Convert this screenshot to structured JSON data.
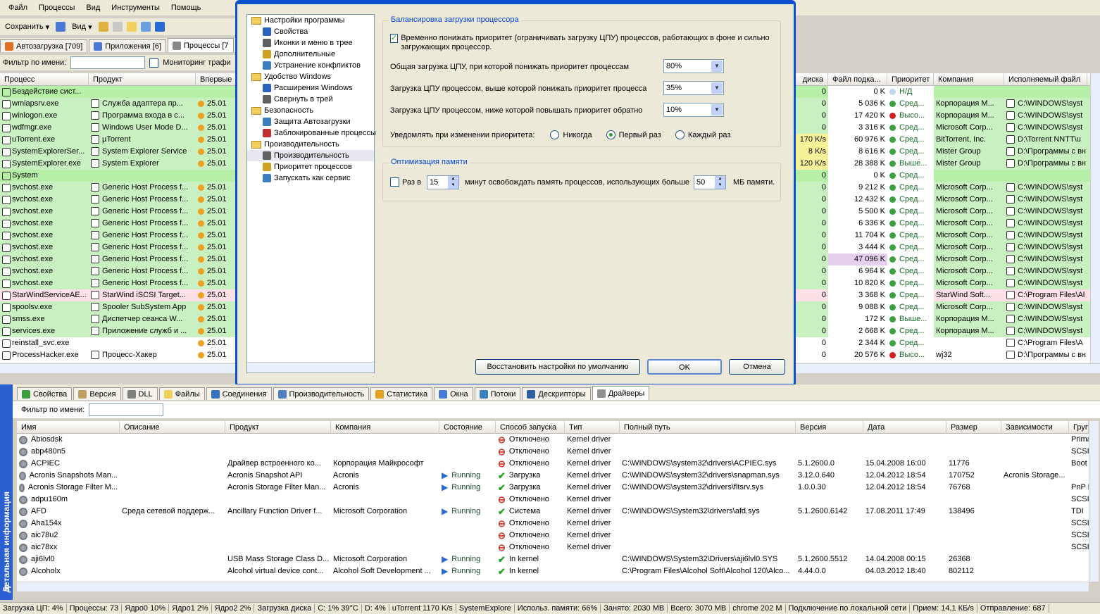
{
  "menu": [
    "Файл",
    "Процессы",
    "Вид",
    "Инструменты",
    "Помощь"
  ],
  "toolbar": {
    "save": "Сохранить",
    "view": "Вид"
  },
  "top_tabs": [
    "Автозагрузка [709]",
    "Приложения [6]",
    "Процессы [7"
  ],
  "filter": {
    "label": "Фильтр по имени:",
    "monitor": "Мониторинг трафи"
  },
  "proc_headers_left": [
    "Процесс",
    "Продукт",
    "Впервые"
  ],
  "proc_headers_right": [
    "диска",
    "Файл подка...",
    "Приоритет",
    "Компания",
    "Исполняемый файл"
  ],
  "processes": [
    {
      "n": "Бездействие сист...",
      "p": "",
      "d": "",
      "disk": "0",
      "f": "0 K",
      "pr": "Н/Д",
      "c": "",
      "e": "",
      "bg": "gb"
    },
    {
      "n": "wmiapsrv.exe",
      "p": "Служба адаптера пр...",
      "d": "25.01",
      "disk": "0",
      "f": "5 036 K",
      "pr": "Сред...",
      "c": "Корпорация M...",
      "e": "C:\\WINDOWS\\syst",
      "bg": "g"
    },
    {
      "n": "winlogon.exe",
      "p": "Программа входа в с...",
      "d": "25.01",
      "disk": "0",
      "f": "17 420 K",
      "pr": "Высо...",
      "c": "Корпорация M...",
      "e": "C:\\WINDOWS\\syst",
      "bg": "g"
    },
    {
      "n": "wdfmgr.exe",
      "p": "Windows User Mode D...",
      "d": "25.01",
      "disk": "0",
      "f": "3 316 K",
      "pr": "Сред...",
      "c": "Microsoft Corp...",
      "e": "C:\\WINDOWS\\syst",
      "bg": "g"
    },
    {
      "n": "uTorrent.exe",
      "p": "µTorrent",
      "d": "25.01",
      "disk": "170 K/s",
      "f": "60 976 K",
      "pr": "Сред...",
      "c": "BitTorrent, Inc.",
      "e": "D:\\Torrent NNTT\\u",
      "bg": "g"
    },
    {
      "n": "SystemExplorerSer...",
      "p": "System Explorer Service",
      "d": "25.01",
      "disk": "8 K/s",
      "f": "8 616 K",
      "pr": "Сред...",
      "c": "Mister Group",
      "e": "D:\\Программы с вн",
      "bg": "g"
    },
    {
      "n": "SystemExplorer.exe",
      "p": "System Explorer",
      "d": "25.01",
      "disk": "120 K/s",
      "f": "28 388 K",
      "pr": "Выше...",
      "c": "Mister Group",
      "e": "D:\\Программы с вн",
      "bg": "g"
    },
    {
      "n": "System",
      "p": "",
      "d": "",
      "disk": "0",
      "f": "0 K",
      "pr": "Сред...",
      "c": "",
      "e": "",
      "bg": "gb"
    },
    {
      "n": "svchost.exe",
      "p": "Generic Host Process f...",
      "d": "25.01",
      "disk": "0",
      "f": "9 212 K",
      "pr": "Сред...",
      "c": "Microsoft Corp...",
      "e": "C:\\WINDOWS\\syst",
      "bg": "g"
    },
    {
      "n": "svchost.exe",
      "p": "Generic Host Process f...",
      "d": "25.01",
      "disk": "0",
      "f": "12 432 K",
      "pr": "Сред...",
      "c": "Microsoft Corp...",
      "e": "C:\\WINDOWS\\syst",
      "bg": "g"
    },
    {
      "n": "svchost.exe",
      "p": "Generic Host Process f...",
      "d": "25.01",
      "disk": "0",
      "f": "5 500 K",
      "pr": "Сред...",
      "c": "Microsoft Corp...",
      "e": "C:\\WINDOWS\\syst",
      "bg": "g"
    },
    {
      "n": "svchost.exe",
      "p": "Generic Host Process f...",
      "d": "25.01",
      "disk": "0",
      "f": "6 336 K",
      "pr": "Сред...",
      "c": "Microsoft Corp...",
      "e": "C:\\WINDOWS\\syst",
      "bg": "g"
    },
    {
      "n": "svchost.exe",
      "p": "Generic Host Process f...",
      "d": "25.01",
      "disk": "0",
      "f": "11 704 K",
      "pr": "Сред...",
      "c": "Microsoft Corp...",
      "e": "C:\\WINDOWS\\syst",
      "bg": "g"
    },
    {
      "n": "svchost.exe",
      "p": "Generic Host Process f...",
      "d": "25.01",
      "disk": "0",
      "f": "3 444 K",
      "pr": "Сред...",
      "c": "Microsoft Corp...",
      "e": "C:\\WINDOWS\\syst",
      "bg": "g"
    },
    {
      "n": "svchost.exe",
      "p": "Generic Host Process f...",
      "d": "25.01",
      "disk": "0",
      "f": "47 096 K",
      "pr": "Сред...",
      "c": "Microsoft Corp...",
      "e": "C:\\WINDOWS\\syst",
      "bg": "g"
    },
    {
      "n": "svchost.exe",
      "p": "Generic Host Process f...",
      "d": "25.01",
      "disk": "0",
      "f": "6 964 K",
      "pr": "Сред...",
      "c": "Microsoft Corp...",
      "e": "C:\\WINDOWS\\syst",
      "bg": "g"
    },
    {
      "n": "svchost.exe",
      "p": "Generic Host Process f...",
      "d": "25.01",
      "disk": "0",
      "f": "10 820 K",
      "pr": "Сред...",
      "c": "Microsoft Corp...",
      "e": "C:\\WINDOWS\\syst",
      "bg": "g"
    },
    {
      "n": "StarWindServiceAE...",
      "p": "StarWind iSCSI Target...",
      "d": "25.01",
      "disk": "0",
      "f": "3 368 K",
      "pr": "Сред...",
      "c": "StarWind Soft...",
      "e": "C:\\Program Files\\Al",
      "bg": "p"
    },
    {
      "n": "spoolsv.exe",
      "p": "Spooler SubSystem App",
      "d": "25.01",
      "disk": "0",
      "f": "9 088 K",
      "pr": "Сред...",
      "c": "Microsoft Corp...",
      "e": "C:\\WINDOWS\\syst",
      "bg": "g"
    },
    {
      "n": "smss.exe",
      "p": "Диспетчер сеанса  W...",
      "d": "25.01",
      "disk": "0",
      "f": "172 K",
      "pr": "Выше...",
      "c": "Корпорация M...",
      "e": "C:\\WINDOWS\\syst",
      "bg": "g"
    },
    {
      "n": "services.exe",
      "p": "Приложение служб и ...",
      "d": "25.01",
      "disk": "0",
      "f": "2 668 K",
      "pr": "Сред...",
      "c": "Корпорация M...",
      "e": "C:\\WINDOWS\\syst",
      "bg": "g"
    },
    {
      "n": "reinstall_svc.exe",
      "p": "",
      "d": "25.01",
      "disk": "0",
      "f": "2 344 K",
      "pr": "Сред...",
      "c": "",
      "e": "C:\\Program Files\\A",
      "bg": ""
    },
    {
      "n": "ProcessHacker.exe",
      "p": "Процесс-Хакер",
      "d": "25.01",
      "disk": "0",
      "f": "20 576 K",
      "pr": "Высо...",
      "c": "wj32",
      "e": "D:\\Программы с вн",
      "bg": ""
    }
  ],
  "dialog": {
    "tree": [
      {
        "t": "Настройки программы",
        "lvl": 0,
        "folder": true
      },
      {
        "t": "Свойства",
        "lvl": 1
      },
      {
        "t": "Иконки и меню в трее",
        "lvl": 1
      },
      {
        "t": "Дополнительные",
        "lvl": 1
      },
      {
        "t": "Устранение конфликтов",
        "lvl": 1
      },
      {
        "t": "Удобство Windows",
        "lvl": 0,
        "folder": true
      },
      {
        "t": "Расширения Windows",
        "lvl": 1
      },
      {
        "t": "Свернуть в трей",
        "lvl": 1
      },
      {
        "t": "Безопасность",
        "lvl": 0,
        "folder": true
      },
      {
        "t": "Защита Автозагрузки",
        "lvl": 1
      },
      {
        "t": "Заблокированные процессы",
        "lvl": 1
      },
      {
        "t": "Производительность",
        "lvl": 0,
        "folder": true
      },
      {
        "t": "Производительность",
        "lvl": 1,
        "sel": true
      },
      {
        "t": "Приоритет процессов",
        "lvl": 1
      },
      {
        "t": "Запускать как сервис",
        "lvl": 1
      }
    ],
    "g1_title": "Балансировка загрузки процессора",
    "g1_check": "Временно понижать приоритет (ограничивать загрузку ЦПУ) процессов, работающих в фоне и сильно загружающих процессор.",
    "r1": "Общая загрузка ЦПУ, при которой понижать приоритет процессам",
    "r1v": "80%",
    "r2": "Загрузка ЦПУ процессом, выше которой понижать приоритет процесса",
    "r2v": "35%",
    "r3": "Загрузка ЦПУ процессом, ниже которой повышать приоритет обратно",
    "r3v": "10%",
    "notify": "Уведомлять при изменении приоритета:",
    "opt_never": "Никогда",
    "opt_first": "Первый раз",
    "opt_each": "Каждый раз",
    "g2_title": "Оптимизация памяти",
    "every": "Раз в",
    "every_v": "15",
    "mid": "минут освобождать память процессов, использующих больше",
    "mb_v": "50",
    "mb": "МБ памяти.",
    "restore": "Восстановить настройки по умолчанию",
    "ok": "OK",
    "cancel": "Отмена"
  },
  "sidebar": "Детальная информация",
  "bottom_tabs": [
    "Свойства",
    "Версия",
    "DLL",
    "Файлы",
    "Соединения",
    "Производительность",
    "Статистика",
    "Окна",
    "Потоки",
    "Дескрипторы",
    "Драйверы"
  ],
  "filter2_label": "Фильтр по имени:",
  "drv_headers": [
    "Имя",
    "Описание",
    "Продукт",
    "Компания",
    "Состояние",
    "Способ запуска",
    "Тип",
    "Полный путь",
    "Версия",
    "Дата",
    "Размер",
    "Зависимости",
    "Групп"
  ],
  "drivers": [
    {
      "n": "Abiosdsk",
      "d": "",
      "p": "",
      "c": "",
      "s": "",
      "m": "Отключено",
      "t": "Kernel driver",
      "path": "",
      "v": "",
      "dt": "",
      "sz": "",
      "dep": "",
      "g": "Primar",
      "mi": "off"
    },
    {
      "n": "abp480n5",
      "d": "",
      "p": "",
      "c": "",
      "s": "",
      "m": "Отключено",
      "t": "Kernel driver",
      "path": "",
      "v": "",
      "dt": "",
      "sz": "",
      "dep": "",
      "g": "SCSI m",
      "mi": "off"
    },
    {
      "n": "ACPIEC",
      "d": "",
      "p": "Драйвер встроенного ко...",
      "c": "Корпорация Майкрософт",
      "s": "",
      "m": "Отключено",
      "t": "Kernel driver",
      "path": "C:\\WINDOWS\\system32\\drivers\\ACPIEC.sys",
      "v": "5.1.2600.0",
      "dt": "15.04.2008 16:00",
      "sz": "11776",
      "dep": "",
      "g": "Boot B",
      "mi": "off"
    },
    {
      "n": "Acronis Snapshots Man...",
      "d": "",
      "p": "Acronis Snapshot API",
      "c": "Acronis",
      "s": "Running",
      "m": "Загрузка",
      "t": "Kernel driver",
      "path": "C:\\WINDOWS\\system32\\drivers\\snapman.sys",
      "v": "3.12.0.640",
      "dt": "12.04.2012 18:54",
      "sz": "170752",
      "dep": "Acronis Storage...",
      "g": "",
      "mi": "ok"
    },
    {
      "n": "Acronis Storage Filter M...",
      "d": "",
      "p": "Acronis Storage Filter Man...",
      "c": "Acronis",
      "s": "Running",
      "m": "Загрузка",
      "t": "Kernel driver",
      "path": "C:\\WINDOWS\\system32\\drivers\\fltsrv.sys",
      "v": "1.0.0.30",
      "dt": "12.04.2012 18:54",
      "sz": "76768",
      "dep": "",
      "g": "PnP Fil",
      "mi": "ok"
    },
    {
      "n": "adpu160m",
      "d": "",
      "p": "",
      "c": "",
      "s": "",
      "m": "Отключено",
      "t": "Kernel driver",
      "path": "",
      "v": "",
      "dt": "",
      "sz": "",
      "dep": "",
      "g": "SCSI m",
      "mi": "off"
    },
    {
      "n": "AFD",
      "d": "Среда сетевой поддерж...",
      "p": "Ancillary Function Driver f...",
      "c": "Microsoft Corporation",
      "s": "Running",
      "m": "Система",
      "t": "Kernel driver",
      "path": "C:\\WINDOWS\\System32\\drivers\\afd.sys",
      "v": "5.1.2600.6142",
      "dt": "17.08.2011 17:49",
      "sz": "138496",
      "dep": "",
      "g": "TDI",
      "mi": "ok"
    },
    {
      "n": "Aha154x",
      "d": "",
      "p": "",
      "c": "",
      "s": "",
      "m": "Отключено",
      "t": "Kernel driver",
      "path": "",
      "v": "",
      "dt": "",
      "sz": "",
      "dep": "",
      "g": "SCSI m",
      "mi": "off"
    },
    {
      "n": "aic78u2",
      "d": "",
      "p": "",
      "c": "",
      "s": "",
      "m": "Отключено",
      "t": "Kernel driver",
      "path": "",
      "v": "",
      "dt": "",
      "sz": "",
      "dep": "",
      "g": "SCSI m",
      "mi": "off"
    },
    {
      "n": "aic78xx",
      "d": "",
      "p": "",
      "c": "",
      "s": "",
      "m": "Отключено",
      "t": "Kernel driver",
      "path": "",
      "v": "",
      "dt": "",
      "sz": "",
      "dep": "",
      "g": "SCSI m",
      "mi": "off"
    },
    {
      "n": "aji6lvl0",
      "d": "",
      "p": "USB Mass Storage Class D...",
      "c": "Microsoft Corporation",
      "s": "Running",
      "m": "In kernel",
      "t": "",
      "path": "C:\\WINDOWS\\System32\\Drivers\\aji6lvl0.SYS",
      "v": "5.1.2600.5512",
      "dt": "14.04.2008 00:15",
      "sz": "26368",
      "dep": "",
      "g": "",
      "mi": "ok"
    },
    {
      "n": "Alcoholx",
      "d": "",
      "p": "Alcohol virtual device cont...",
      "c": "Alcohol Soft Development ...",
      "s": "Running",
      "m": "In kernel",
      "t": "",
      "path": "C:\\Program Files\\Alcohol Soft\\Alcohol 120\\Alco...",
      "v": "4.44.0.0",
      "dt": "04.03.2012 18:40",
      "sz": "802112",
      "dep": "",
      "g": "",
      "mi": "ok"
    }
  ],
  "status": [
    "Загрузка ЦП: 4%",
    "Процессы: 73",
    "Ядро0 10%",
    "Ядро1 2%",
    "Ядро2 2%",
    "Загрузка диска",
    "C: 1% 39°C",
    "D: 4%",
    "uTorrent 1170 K/s",
    "SystemExplore",
    "Использ. памяти: 66%",
    "Занято: 2030 MB",
    "Всего: 3070 MB",
    "chrome 202 M",
    "Подключение по локальной сети",
    "Прием: 14,1 КБ/s",
    "Отправление: 687"
  ]
}
